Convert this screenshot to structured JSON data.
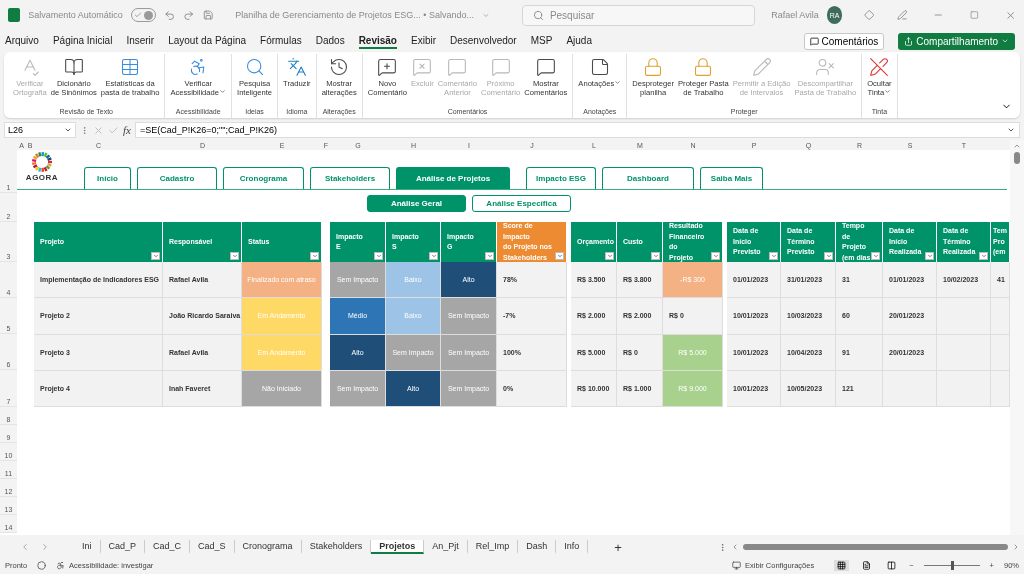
{
  "title_bar": {
    "autosave_label": "Salvamento Automático",
    "autosave_on": true,
    "document_title": "Planilha de Gerenciamento de Projetos ESG... • Salvando...",
    "search": {
      "placeholder": "Pesquisar"
    },
    "user_name": "Rafael Avila",
    "avatar_initials": "RA"
  },
  "menu": {
    "items": [
      {
        "label": "Arquivo",
        "selected": false
      },
      {
        "label": "Página Inicial",
        "selected": false
      },
      {
        "label": "Inserir",
        "selected": false
      },
      {
        "label": "Layout da Página",
        "selected": false
      },
      {
        "label": "Fórmulas",
        "selected": false
      },
      {
        "label": "Dados",
        "selected": false
      },
      {
        "label": "Revisão",
        "selected": true
      },
      {
        "label": "Exibir",
        "selected": false
      },
      {
        "label": "Desenvolvedor",
        "selected": false
      },
      {
        "label": "MSP",
        "selected": false
      },
      {
        "label": "Ajuda",
        "selected": false
      }
    ],
    "comments_button": "Comentários",
    "share_button": "Compartilhamento"
  },
  "ribbon": {
    "groups": [
      {
        "label": "Revisão de Texto",
        "buttons": [
          {
            "label": "Verificar\nOrtografia",
            "disabled": true
          },
          {
            "label": "Dicionário\nde Sinônimos",
            "disabled": false
          },
          {
            "label": "Estatísticas da\npasta de trabalho",
            "disabled": false
          }
        ]
      },
      {
        "label": "Acessibilidade",
        "buttons": [
          {
            "label": "Verificar\nAcessibilidade",
            "disabled": false,
            "dropdown": true
          }
        ]
      },
      {
        "label": "Ideias",
        "buttons": [
          {
            "label": "Pesquisa\nInteligente",
            "disabled": false
          }
        ]
      },
      {
        "label": "Idioma",
        "buttons": [
          {
            "label": "Traduzir",
            "disabled": false
          }
        ]
      },
      {
        "label": "Alterações",
        "buttons": [
          {
            "label": "Mostrar\nalterações",
            "disabled": false
          }
        ]
      },
      {
        "label": "Comentários",
        "buttons": [
          {
            "label": "Novo\nComentário",
            "disabled": false
          },
          {
            "label": "Excluir",
            "disabled": true
          },
          {
            "label": "Comentário\nAnterior",
            "disabled": true
          },
          {
            "label": "Próximo\nComentário",
            "disabled": true
          },
          {
            "label": "Mostrar\nComentários",
            "disabled": false
          }
        ]
      },
      {
        "label": "Anotações",
        "buttons": [
          {
            "label": "Anotações",
            "disabled": false,
            "dropdown": true
          }
        ]
      },
      {
        "label": "Proteger",
        "buttons": [
          {
            "label": "Desproteger\nplanilha",
            "disabled": false
          },
          {
            "label": "Proteger Pasta\nde Trabalho",
            "disabled": false
          },
          {
            "label": "Permitir a Edição\nde Intervalos",
            "disabled": true
          },
          {
            "label": "Descompartilhar\nPasta de Trabalho",
            "disabled": true
          }
        ]
      },
      {
        "label": "Tinta",
        "buttons": [
          {
            "label": "Ocultar\nTinta",
            "disabled": false,
            "dropdown": true
          }
        ]
      }
    ]
  },
  "formula_bar": {
    "name_box": "L26",
    "fx": "fx",
    "formula": "=SE(Cad_P!K26=0;\"\";Cad_P!K26)"
  },
  "column_letters": [
    "A",
    "B",
    "C",
    "D",
    "E",
    "F",
    "G",
    "H",
    "I",
    "J",
    "L",
    "M",
    "N",
    "P",
    "Q",
    "R",
    "S",
    "T"
  ],
  "row_numbers": [
    "1",
    "2",
    "3",
    "4",
    "5",
    "6",
    "7",
    "8",
    "9",
    "10",
    "11",
    "12",
    "13",
    "14"
  ],
  "logo_text": "AGORA",
  "nav_tabs": [
    {
      "label": "Início",
      "selected": false
    },
    {
      "label": "Cadastro",
      "selected": false
    },
    {
      "label": "Cronograma",
      "selected": false
    },
    {
      "label": "Stakeholders",
      "selected": false
    },
    {
      "label": "Análise de Projetos",
      "selected": true
    },
    {
      "label": "Impacto ESG",
      "selected": false
    },
    {
      "label": "Dashboard",
      "selected": false
    },
    {
      "label": "Saiba Mais",
      "selected": false
    }
  ],
  "sub_tabs": [
    {
      "label": "Análise Geral",
      "selected": true
    },
    {
      "label": "Análise Específica",
      "selected": false
    }
  ],
  "table": {
    "column_groups": [
      {
        "columns": [
          {
            "label": "Projeto",
            "color": "#00936a"
          },
          {
            "label": "Responsável",
            "color": "#00936a"
          },
          {
            "label": "Status",
            "color": "#00936a"
          }
        ]
      },
      {
        "columns": [
          {
            "label": "Impacto\nE",
            "color": "#00936a"
          },
          {
            "label": "Impacto\nS",
            "color": "#00936a"
          },
          {
            "label": "Impacto\nG",
            "color": "#00936a"
          },
          {
            "label": "Score de Impacto\ndo Projeto nos\nStakeholders",
            "color": "#ed8b32"
          }
        ]
      },
      {
        "columns": [
          {
            "label": "Orçamento",
            "color": "#00936a"
          },
          {
            "label": "Custo",
            "color": "#00936a"
          },
          {
            "label": "Resultado\nFinanceiro do\nProjeto",
            "color": "#00936a"
          }
        ]
      },
      {
        "columns": [
          {
            "label": "Data de Início\nPrevisto",
            "color": "#00936a"
          },
          {
            "label": "Data de\nTérmino\nPrevisto",
            "color": "#00936a"
          },
          {
            "label": "Tempo de\nProjeto\n(em dias",
            "color": "#00936a"
          },
          {
            "label": "Data de Início\nRealizada",
            "color": "#00936a"
          },
          {
            "label": "Data de\nTérmino\nRealizada",
            "color": "#00936a"
          },
          {
            "label": "Tem\nPro\n(em",
            "color": "#00936a"
          }
        ]
      }
    ],
    "rows": [
      {
        "cells": [
          {
            "text": "Implementação de Indicadores ESG"
          },
          {
            "text": "Rafael Avila"
          },
          {
            "text": "Finalizado com atraso",
            "color": "#f4b183"
          },
          {
            "text": "Sem Impacto",
            "color": "#a6a6a6"
          },
          {
            "text": "Baixo",
            "color": "#9dc3e6"
          },
          {
            "text": "Alto",
            "color": "#1f4e79"
          },
          {
            "text": "78%"
          },
          {
            "text": "R$ 3.500"
          },
          {
            "text": "R$ 3.800"
          },
          {
            "text": "-R$ 300",
            "color": "#f4b183"
          },
          {
            "text": "01/01/2023"
          },
          {
            "text": "31/01/2023"
          },
          {
            "text": "31"
          },
          {
            "text": "01/01/2023"
          },
          {
            "text": "10/02/2023"
          },
          {
            "text": "41"
          }
        ]
      },
      {
        "cells": [
          {
            "text": "Projeto 2"
          },
          {
            "text": "João Ricardo Saraiva"
          },
          {
            "text": "Em Andamento",
            "color": "#ffd966"
          },
          {
            "text": "Médio",
            "color": "#2e75b6"
          },
          {
            "text": "Baixo",
            "color": "#9dc3e6"
          },
          {
            "text": "Sem Impacto",
            "color": "#a6a6a6"
          },
          {
            "text": "-7%"
          },
          {
            "text": "R$ 2.000"
          },
          {
            "text": "R$ 2.000"
          },
          {
            "text": "R$ 0"
          },
          {
            "text": "10/01/2023"
          },
          {
            "text": "10/03/2023"
          },
          {
            "text": "60"
          },
          {
            "text": "20/01/2023"
          },
          null,
          null
        ]
      },
      {
        "cells": [
          {
            "text": "Projeto 3"
          },
          {
            "text": "Rafael Avila"
          },
          {
            "text": "Em Andamento",
            "color": "#ffd966"
          },
          {
            "text": "Alto",
            "color": "#1f4e79"
          },
          {
            "text": "Sem Impacto",
            "color": "#a6a6a6"
          },
          {
            "text": "Sem Impacto",
            "color": "#a6a6a6"
          },
          {
            "text": "100%"
          },
          {
            "text": "R$ 5.000"
          },
          {
            "text": "R$ 0"
          },
          {
            "text": "R$ 5.000",
            "color": "#a9d18e"
          },
          {
            "text": "10/01/2023"
          },
          {
            "text": "10/04/2023"
          },
          {
            "text": "91"
          },
          {
            "text": "20/01/2023"
          },
          null,
          null
        ]
      },
      {
        "cells": [
          {
            "text": "Projeto 4"
          },
          {
            "text": "Inah Faveret"
          },
          {
            "text": "Não Iniciado",
            "color": "#a6a6a6"
          },
          {
            "text": "Sem Impacto",
            "color": "#a6a6a6"
          },
          {
            "text": "Alto",
            "color": "#1f4e79"
          },
          {
            "text": "Sem Impacto",
            "color": "#a6a6a6"
          },
          {
            "text": "0%"
          },
          {
            "text": "R$ 10.000"
          },
          {
            "text": "R$ 1.000"
          },
          {
            "text": "R$ 9.000",
            "color": "#a9d18e"
          },
          {
            "text": "10/01/2023"
          },
          {
            "text": "10/05/2023"
          },
          {
            "text": "121"
          },
          null,
          null,
          null
        ]
      }
    ]
  },
  "sheet_tabs": [
    {
      "label": "Ini",
      "selected": false
    },
    {
      "label": "Cad_P",
      "selected": false
    },
    {
      "label": "Cad_C",
      "selected": false
    },
    {
      "label": "Cad_S",
      "selected": false
    },
    {
      "label": "Cronograma",
      "selected": false
    },
    {
      "label": "Stakeholders",
      "selected": false
    },
    {
      "label": "Projetos",
      "selected": true
    },
    {
      "label": "An_Pjt",
      "selected": false
    },
    {
      "label": "Rel_Imp",
      "selected": false
    },
    {
      "label": "Dash",
      "selected": false
    },
    {
      "label": "Info",
      "selected": false
    }
  ],
  "add_sheet": "+",
  "status_bar": {
    "ready": "Pronto",
    "accessibility": "Acessibilidade: investigar",
    "display_settings": "Exibir Configurações",
    "zoom_minus": "−",
    "zoom_plus": "+",
    "zoom": {
      "level": 0.5
    },
    "zoom_reading": "90%"
  }
}
